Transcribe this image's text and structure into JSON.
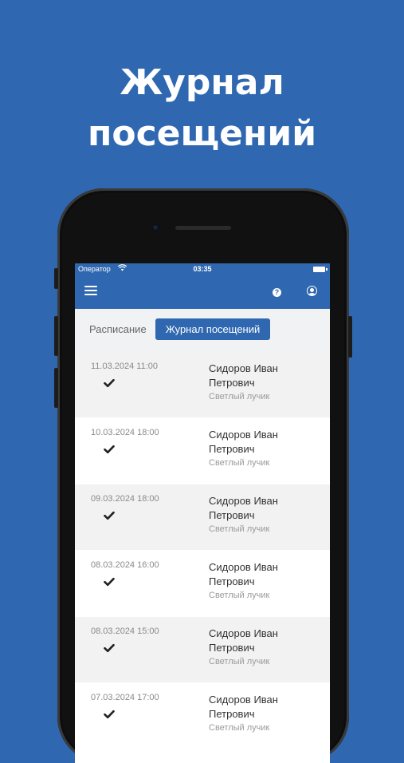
{
  "headline": {
    "line1": "Журнал",
    "line2": "посещений"
  },
  "statusbar": {
    "carrier": "Оператор",
    "time": "03:35"
  },
  "navbar": {
    "help_symbol": "?"
  },
  "tabs": {
    "schedule": "Расписание",
    "journal": "Журнал посещений"
  },
  "icons": {
    "menu": "hamburger-icon",
    "help": "help-icon",
    "profile": "user-icon",
    "mark": "check-icon"
  },
  "colors": {
    "brand": "#2f68b0",
    "row_shade": "#f2f2f2"
  },
  "visits": [
    {
      "date": "11.03.2024 11:00",
      "name": "Сидоров Иван Петрович",
      "group": "Светлый лучик"
    },
    {
      "date": "10.03.2024 18:00",
      "name": "Сидоров Иван Петрович",
      "group": "Светлый лучик"
    },
    {
      "date": "09.03.2024 18:00",
      "name": "Сидоров Иван Петрович",
      "group": "Светлый лучик"
    },
    {
      "date": "08.03.2024 16:00",
      "name": "Сидоров Иван Петрович",
      "group": "Светлый лучик"
    },
    {
      "date": "08.03.2024 15:00",
      "name": "Сидоров Иван Петрович",
      "group": "Светлый лучик"
    },
    {
      "date": "07.03.2024 17:00",
      "name": "Сидоров Иван Петрович",
      "group": "Светлый лучик"
    }
  ]
}
